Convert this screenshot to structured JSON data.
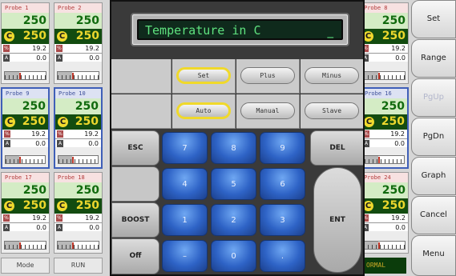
{
  "probes": [
    {
      "label": "Probe  1",
      "value": "250",
      "setpoint": "250",
      "pct": "19.2",
      "amps": "0.0",
      "level": 0.35,
      "selected": false
    },
    {
      "label": "Probe  2",
      "value": "250",
      "setpoint": "250",
      "pct": "19.2",
      "amps": "0.0",
      "level": 0.35,
      "selected": false
    },
    {
      "label": "Probe  9",
      "value": "250",
      "setpoint": "250",
      "pct": "19.2",
      "amps": "0.0",
      "level": 0.35,
      "selected": true
    },
    {
      "label": "Probe 10",
      "value": "250",
      "setpoint": "250",
      "pct": "19.2",
      "amps": "0.0",
      "level": 0.35,
      "selected": true
    },
    {
      "label": "Probe 17",
      "value": "250",
      "setpoint": "250",
      "pct": "19.2",
      "amps": "0.0",
      "level": 0.35,
      "selected": false
    },
    {
      "label": "Probe 18",
      "value": "250",
      "setpoint": "250",
      "pct": "19.2",
      "amps": "0.0",
      "level": 0.35,
      "selected": false
    },
    {
      "label": "Probe  8",
      "value": "250",
      "setpoint": "250",
      "pct": "19.2",
      "amps": "0.0",
      "level": 0.35,
      "selected": false
    },
    {
      "label": "Probe 16",
      "value": "250",
      "setpoint": "250",
      "pct": "19.2",
      "amps": "0.0",
      "level": 0.35,
      "selected": true
    },
    {
      "label": "Probe 24",
      "value": "250",
      "setpoint": "250",
      "pct": "19.2",
      "amps": "0.0",
      "level": 0.35,
      "selected": false
    }
  ],
  "units": {
    "celsius": "C",
    "percent": "%",
    "amps": "A"
  },
  "status": {
    "mode_label": "Mode",
    "mode_value": "RUN",
    "normal_text": "ORMAL"
  },
  "side_buttons": {
    "set": "Set",
    "range": "Range",
    "pgup": "PgUp",
    "pgdn": "PgDn",
    "graph": "Graph",
    "cancel": "Cancel",
    "menu": "Menu"
  },
  "dialog": {
    "title": "Temperature in C",
    "cursor": "_",
    "buttons": {
      "set": "Set",
      "plus": "Plus",
      "minus": "Minus",
      "auto": "Auto",
      "manual": "Manual",
      "slave": "Slave"
    },
    "esc": "ESC",
    "del": "DEL",
    "boost": "BOOST",
    "off": "Off",
    "ent": "ENT",
    "keys": {
      "k7": "7",
      "k8": "8",
      "k9": "9",
      "k4": "4",
      "k5": "5",
      "k6": "6",
      "k1": "1",
      "k2": "2",
      "k3": "3",
      "minus": "–",
      "k0": "0",
      "dot": "."
    }
  },
  "colors": {
    "accent_yellow": "#f0d92a",
    "keypad_blue": "#2e63c6",
    "lcd_green": "#5fe27f",
    "setpoint_bg": "#134c10"
  }
}
